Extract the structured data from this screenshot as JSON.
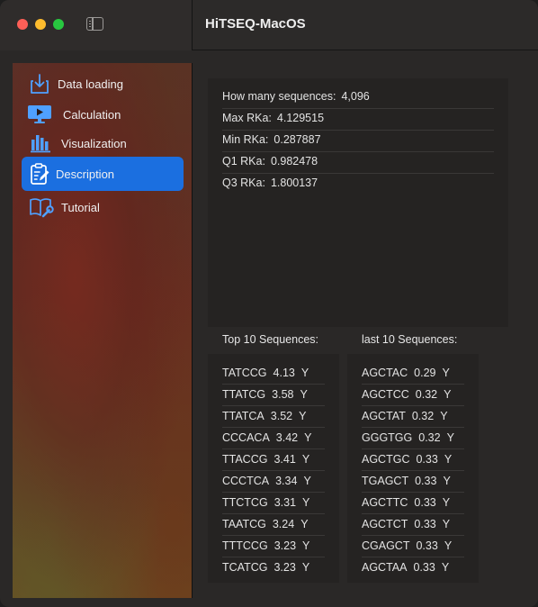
{
  "window": {
    "title": "HiTSEQ-MacOS"
  },
  "sidebar": {
    "items": [
      {
        "label": "Data loading",
        "icon": "download-tray-icon",
        "active": false
      },
      {
        "label": "Calculation",
        "icon": "play-display-icon",
        "active": false
      },
      {
        "label": "Visualization",
        "icon": "bar-chart-icon",
        "active": false
      },
      {
        "label": "Description",
        "icon": "clipboard-edit-icon",
        "active": true
      },
      {
        "label": "Tutorial",
        "icon": "book-wrench-icon",
        "active": false
      }
    ],
    "accent_color": "#1b6fe0"
  },
  "stats": {
    "rows": [
      {
        "label": "How many sequences:",
        "value": "4,096"
      },
      {
        "label": "Max RKa:",
        "value": "4.129515"
      },
      {
        "label": "Min RKa:",
        "value": "0.287887"
      },
      {
        "label": "Q1 RKa:",
        "value": "0.982478"
      },
      {
        "label": "Q3 RKa:",
        "value": "1.800137"
      }
    ]
  },
  "top_sequences": {
    "title": "Top 10 Sequences:",
    "rows": [
      {
        "seq": "TATCCG",
        "score": "4.13",
        "flag": "Y"
      },
      {
        "seq": "TTATCG",
        "score": "3.58",
        "flag": "Y"
      },
      {
        "seq": "TTATCA",
        "score": "3.52",
        "flag": "Y"
      },
      {
        "seq": "CCCACA",
        "score": "3.42",
        "flag": "Y"
      },
      {
        "seq": "TTACCG",
        "score": "3.41",
        "flag": "Y"
      },
      {
        "seq": "CCCTCA",
        "score": "3.34",
        "flag": "Y"
      },
      {
        "seq": "TTCTCG",
        "score": "3.31",
        "flag": "Y"
      },
      {
        "seq": "TAATCG",
        "score": "3.24",
        "flag": "Y"
      },
      {
        "seq": "TTTCCG",
        "score": "3.23",
        "flag": "Y"
      },
      {
        "seq": "TCATCG",
        "score": "3.23",
        "flag": "Y"
      }
    ]
  },
  "last_sequences": {
    "title": "last 10 Sequences:",
    "rows": [
      {
        "seq": "AGCTAC",
        "score": "0.29",
        "flag": "Y"
      },
      {
        "seq": "AGCTCC",
        "score": "0.32",
        "flag": "Y"
      },
      {
        "seq": "AGCTAT",
        "score": "0.32",
        "flag": "Y"
      },
      {
        "seq": "GGGTGG",
        "score": "0.32",
        "flag": "Y"
      },
      {
        "seq": "AGCTGC",
        "score": "0.33",
        "flag": "Y"
      },
      {
        "seq": "TGAGCT",
        "score": "0.33",
        "flag": "Y"
      },
      {
        "seq": "AGCTTC",
        "score": "0.33",
        "flag": "Y"
      },
      {
        "seq": "AGCTCT",
        "score": "0.33",
        "flag": "Y"
      },
      {
        "seq": "CGAGCT",
        "score": "0.33",
        "flag": "Y"
      },
      {
        "seq": "AGCTAA",
        "score": "0.33",
        "flag": "Y"
      }
    ]
  }
}
